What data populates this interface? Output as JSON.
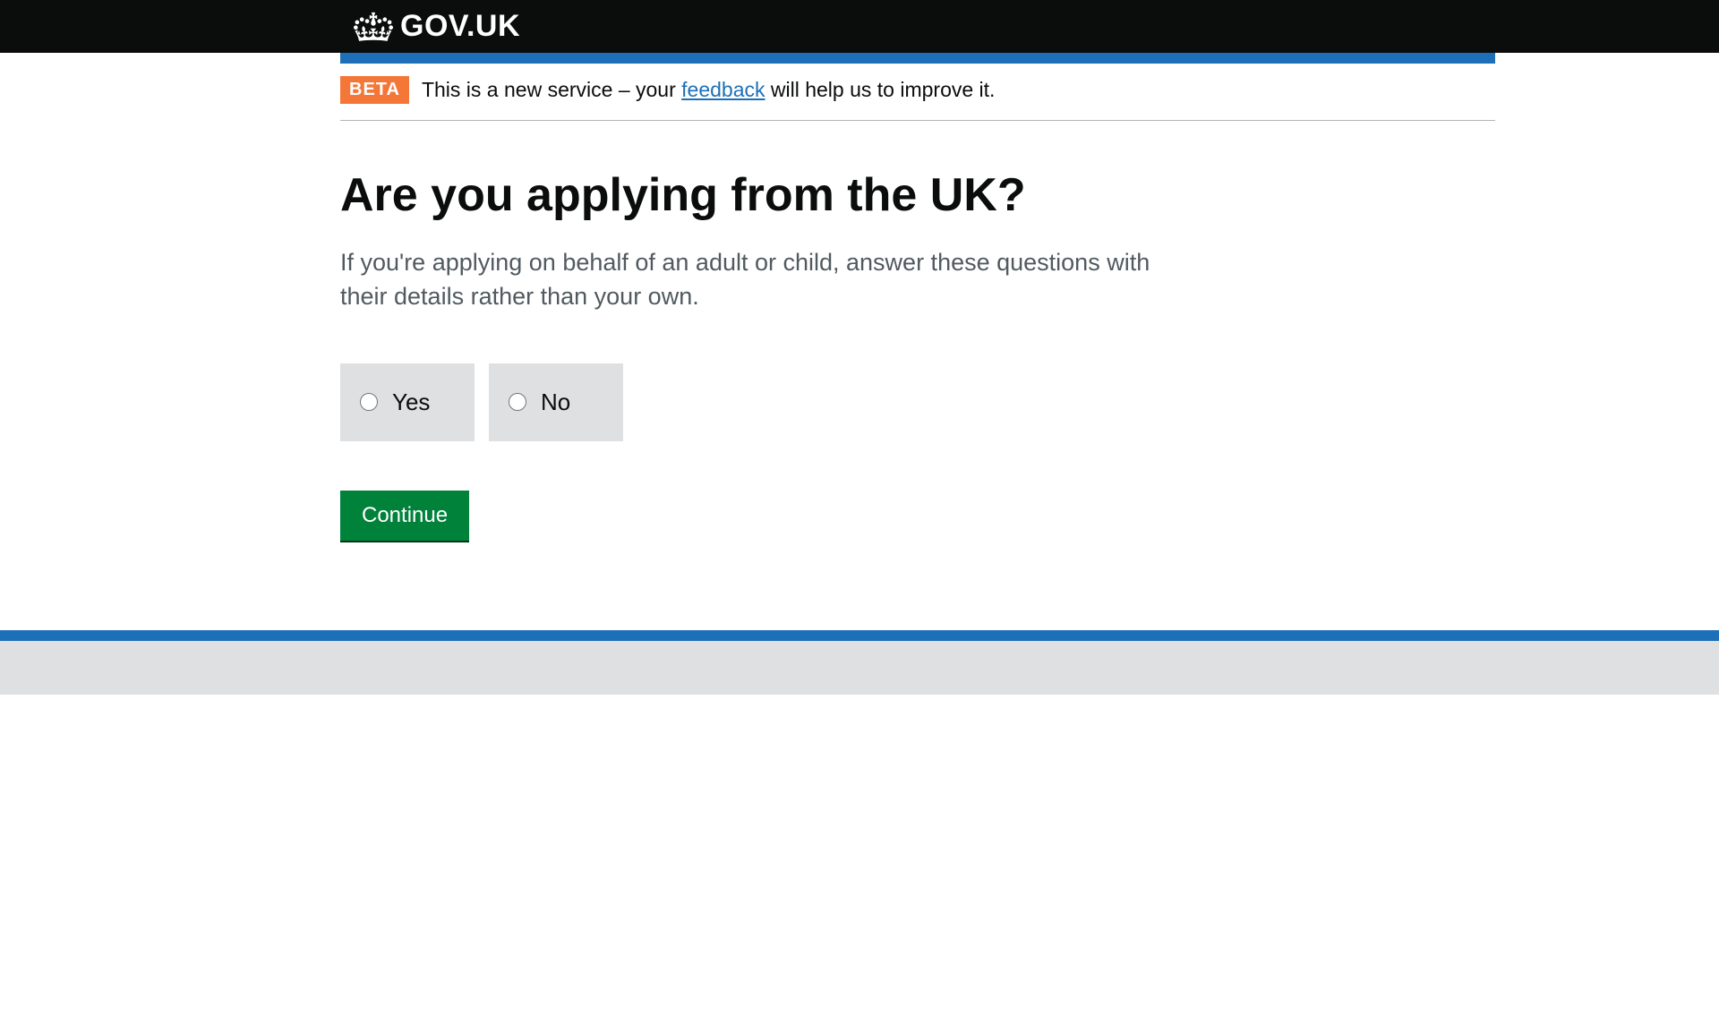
{
  "header": {
    "site_name": "GOV.UK"
  },
  "phase_banner": {
    "tag": "BETA",
    "text_before": "This is a new service – your ",
    "link_text": "feedback",
    "text_after": " will help us to improve it."
  },
  "main": {
    "heading": "Are you applying from the UK?",
    "hint": "If you're applying on behalf of an adult or child, answer these questions with their details rather than your own.",
    "options": {
      "yes": "Yes",
      "no": "No"
    },
    "continue_label": "Continue"
  }
}
